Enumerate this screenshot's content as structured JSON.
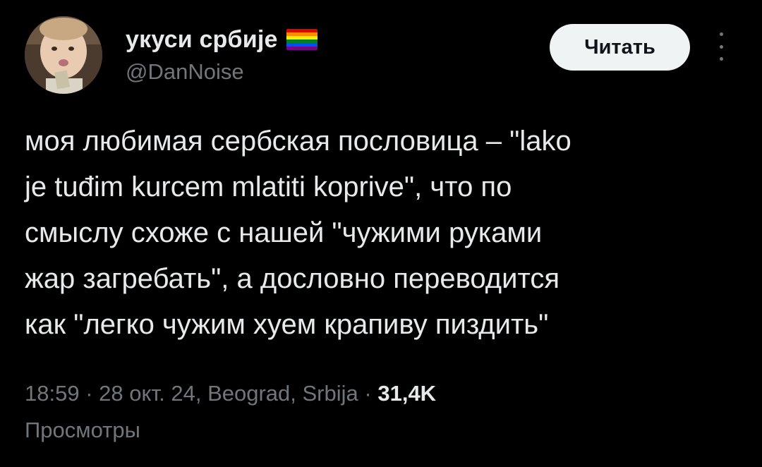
{
  "author": {
    "display_name": "укуси србије",
    "handle": "@DanNoise",
    "flag_icon": "rainbow-flag-icon",
    "flag_colors": [
      "#e40303",
      "#ff8c00",
      "#ffed00",
      "#008026",
      "#004dff",
      "#750787"
    ]
  },
  "follow_button": {
    "label": "Читать"
  },
  "tweet": {
    "lines": [
      "моя любимая сербская пословица – \"lako",
      "je tuđim kurcem mlatiti koprive\", что по",
      "смыслу схоже с нашей \"чужими руками",
      "жар загребать\", а дословно переводится",
      "как \"легко чужим хуем крапиву пиздить\""
    ]
  },
  "meta": {
    "time": "18:59",
    "separator": " · ",
    "date": "28 окт. 24, Beograd, Srbija",
    "views_count": "31,4K",
    "views_label": "Просмотры"
  },
  "colors": {
    "background": "#000000",
    "primary_text": "#e7e9ea",
    "secondary_text": "#71767b",
    "button_bg": "#eff3f4"
  }
}
